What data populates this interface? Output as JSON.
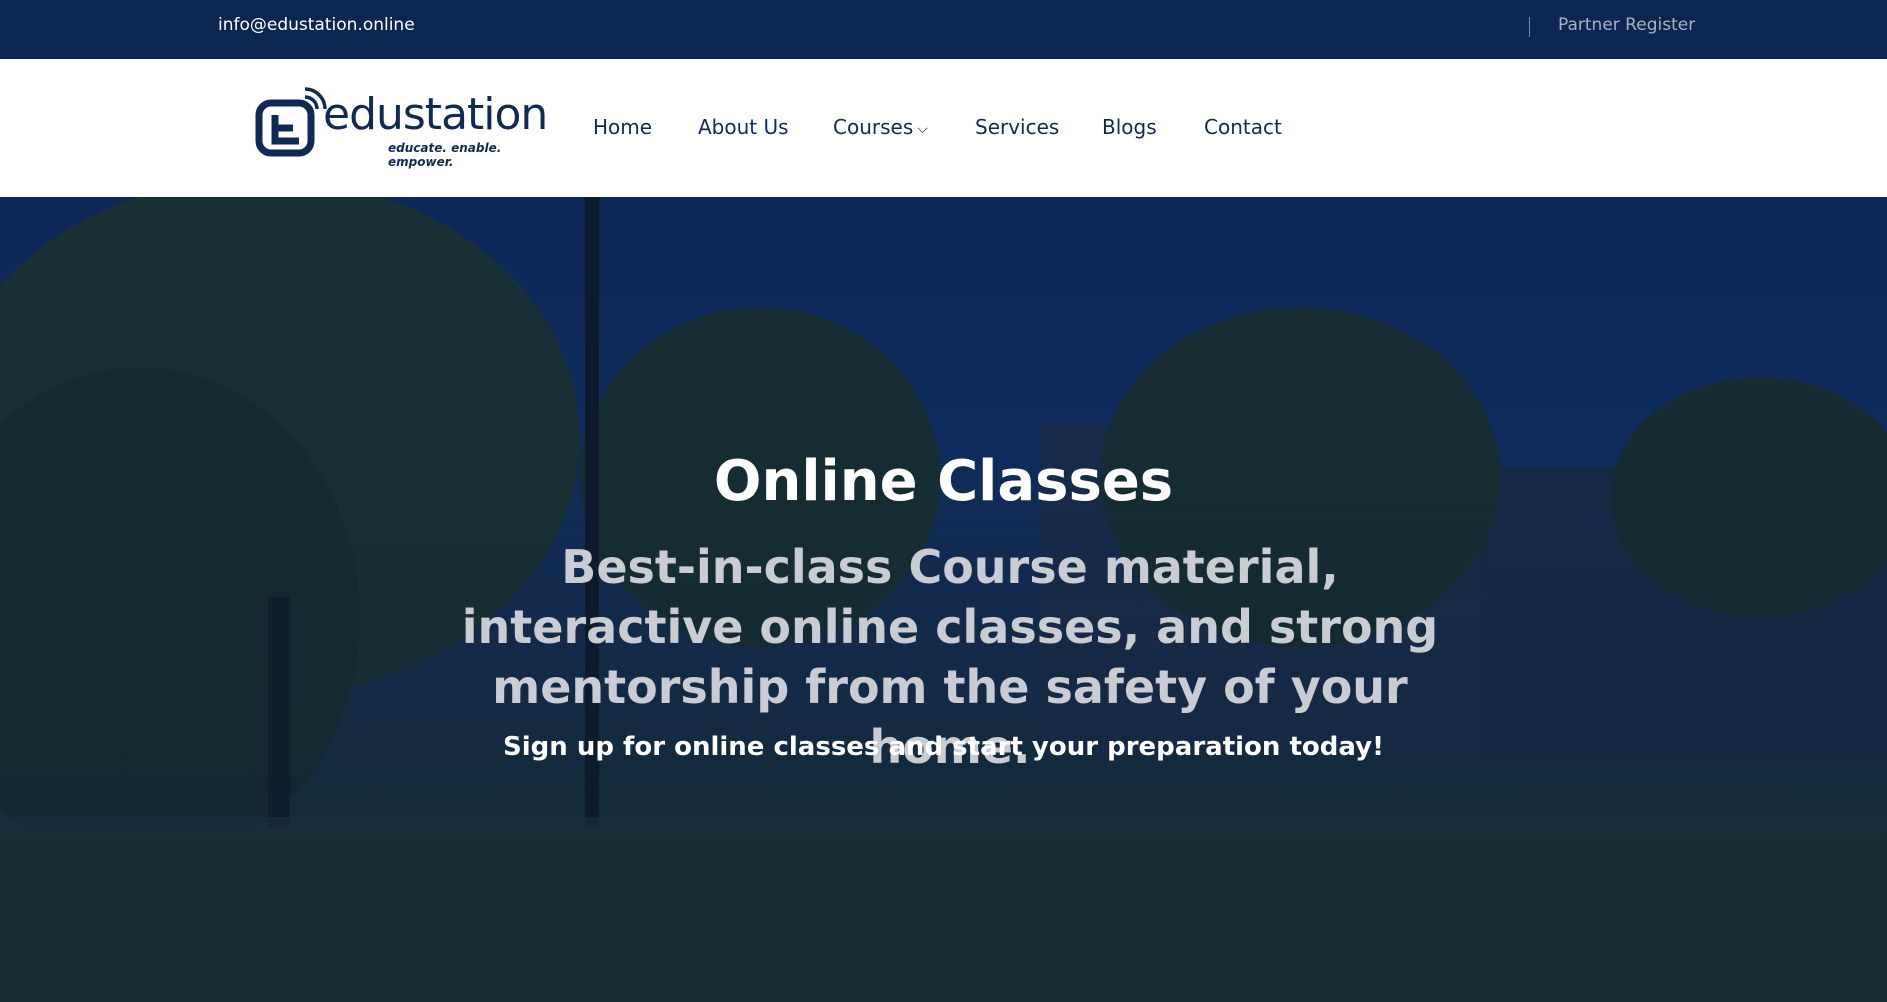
{
  "topbar": {
    "email": "info@edustation.online",
    "partner_register": "Partner Register"
  },
  "logo": {
    "wordmark": "edustation",
    "tagline": "educate. enable. empower."
  },
  "nav": {
    "items": [
      {
        "label": "Home"
      },
      {
        "label": "About Us"
      },
      {
        "label": "Courses"
      },
      {
        "label": "Services"
      },
      {
        "label": "Blogs"
      },
      {
        "label": "Contact"
      }
    ],
    "courses_chevron": "⌵"
  },
  "hero": {
    "title": "Online Classes",
    "subtitle": "Best-in-class Course material, interactive online classes, and strong mentorship from the safety of your home.",
    "cta": "Sign up for online classes and start your preparation today!"
  },
  "colors": {
    "brand_navy": "#0b2650",
    "nav_text": "#0f2b55"
  }
}
